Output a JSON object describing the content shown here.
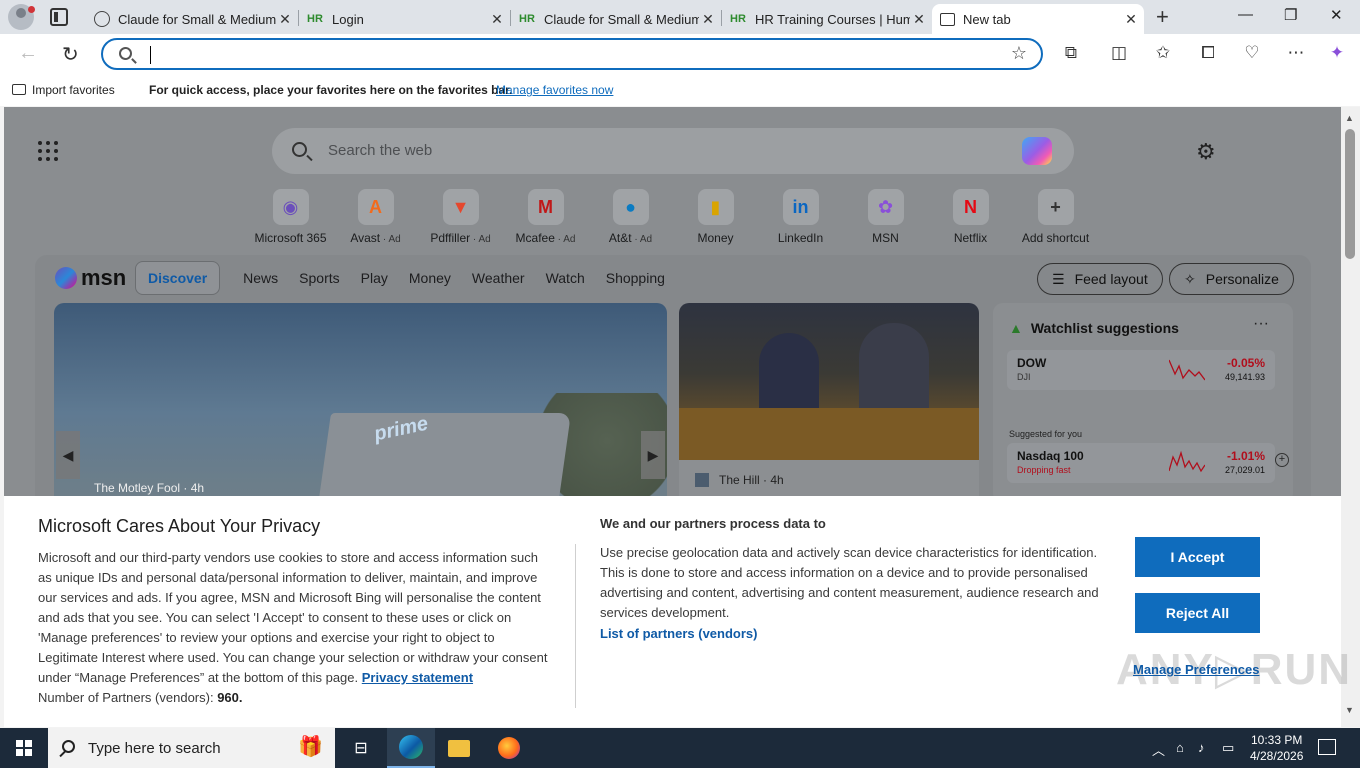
{
  "browser": {
    "tabs": [
      {
        "title": "Claude for Small & Medium",
        "favicon": "globe-icon"
      },
      {
        "title": "Login",
        "favicon": "HR"
      },
      {
        "title": "Claude for Small & Medium",
        "favicon": "HR"
      },
      {
        "title": "HR Training Courses | Huma",
        "favicon": "HR"
      },
      {
        "title": "New tab",
        "favicon": "new-tab-icon",
        "active": true
      }
    ],
    "close_glyph": "✕",
    "new_tab_glyph": "+",
    "window": {
      "minimize": "—",
      "maximize": "❐",
      "close": "✕"
    },
    "address_bar": {
      "value": "",
      "placeholder": ""
    },
    "favorites_bar": {
      "import_label": "Import favorites",
      "message": "For quick access, place your favorites here on the favorites bar.",
      "manage_link": "Manage favorites now"
    }
  },
  "ntp": {
    "search_placeholder": "Search the web",
    "shortcuts": [
      {
        "label": "Microsoft 365",
        "ad": "",
        "glyph": "◉",
        "color": "#6b4fbb"
      },
      {
        "label": "Avast",
        "ad": " · Ad",
        "glyph": "A",
        "color": "#f26b1d"
      },
      {
        "label": "Pdffiller",
        "ad": " · Ad",
        "glyph": "▼",
        "color": "#e5472d"
      },
      {
        "label": "Mcafee",
        "ad": " · Ad",
        "glyph": "M",
        "color": "#c01818"
      },
      {
        "label": "At&t",
        "ad": " · Ad",
        "glyph": "●",
        "color": "#0a7bc2"
      },
      {
        "label": "Money",
        "ad": "",
        "glyph": "▮",
        "color": "#d9a400"
      },
      {
        "label": "LinkedIn",
        "ad": "",
        "glyph": "in",
        "color": "#0a66c2"
      },
      {
        "label": "MSN",
        "ad": "",
        "glyph": "✿",
        "color": "#8a4fd9"
      },
      {
        "label": "Netflix",
        "ad": "",
        "glyph": "N",
        "color": "#e50914"
      },
      {
        "label": "Add shortcut",
        "ad": "",
        "glyph": "+",
        "color": "#333333"
      }
    ],
    "feed": {
      "logo": "msn",
      "nav": [
        "Discover",
        "News",
        "Sports",
        "Play",
        "Money",
        "Weather",
        "Watch",
        "Shopping"
      ],
      "feed_layout": "Feed layout",
      "personalize": "Personalize",
      "hero": {
        "prime_text": "prime",
        "source": "The Motley Fool · 4h"
      },
      "card2": {
        "source": "The Hill · 4h"
      },
      "watchlist": {
        "title": "Watchlist suggestions",
        "more": "···",
        "suggested_for_you": "Suggested for you",
        "stocks": [
          {
            "name": "DOW",
            "sub": "DJI",
            "change": "-0.05%",
            "value": "49,141.93"
          },
          {
            "name": "Nasdaq 100",
            "sub": "Dropping fast",
            "change": "-1.01%",
            "value": "27,029.01"
          }
        ]
      }
    }
  },
  "privacy": {
    "title": "Microsoft Cares About Your Privacy",
    "body": "Microsoft and our third-party vendors use cookies to store and access information such as unique IDs and personal data/personal information to deliver, maintain, and improve our services and ads. If you agree, MSN and Microsoft Bing will personalise the content and ads that you see. You can select 'I Accept' to consent to these uses or click on 'Manage preferences' to review your options and exercise your right to object to Legitimate Interest where used. You can change your selection or withdraw your consent under “Manage Preferences” at the bottom of this page.",
    "privacy_link": "Privacy statement",
    "partners_label": "Number of Partners (vendors):",
    "partners_count": "960.",
    "subtitle": "We and our partners process data to",
    "body2": "Use precise geolocation data and actively scan device characteristics for identification. This is done to store and access information on a device and to provide personalised advertising and content, advertising and content measurement, audience research and services development.",
    "partners_link": "List of partners (vendors)",
    "accept": "I Accept",
    "reject": "Reject All",
    "manage": "Manage Preferences",
    "watermark": "ANY▷RUN"
  },
  "taskbar": {
    "search_placeholder": "Type here to search",
    "time": "10:33 PM",
    "date": "4/28/2026"
  }
}
